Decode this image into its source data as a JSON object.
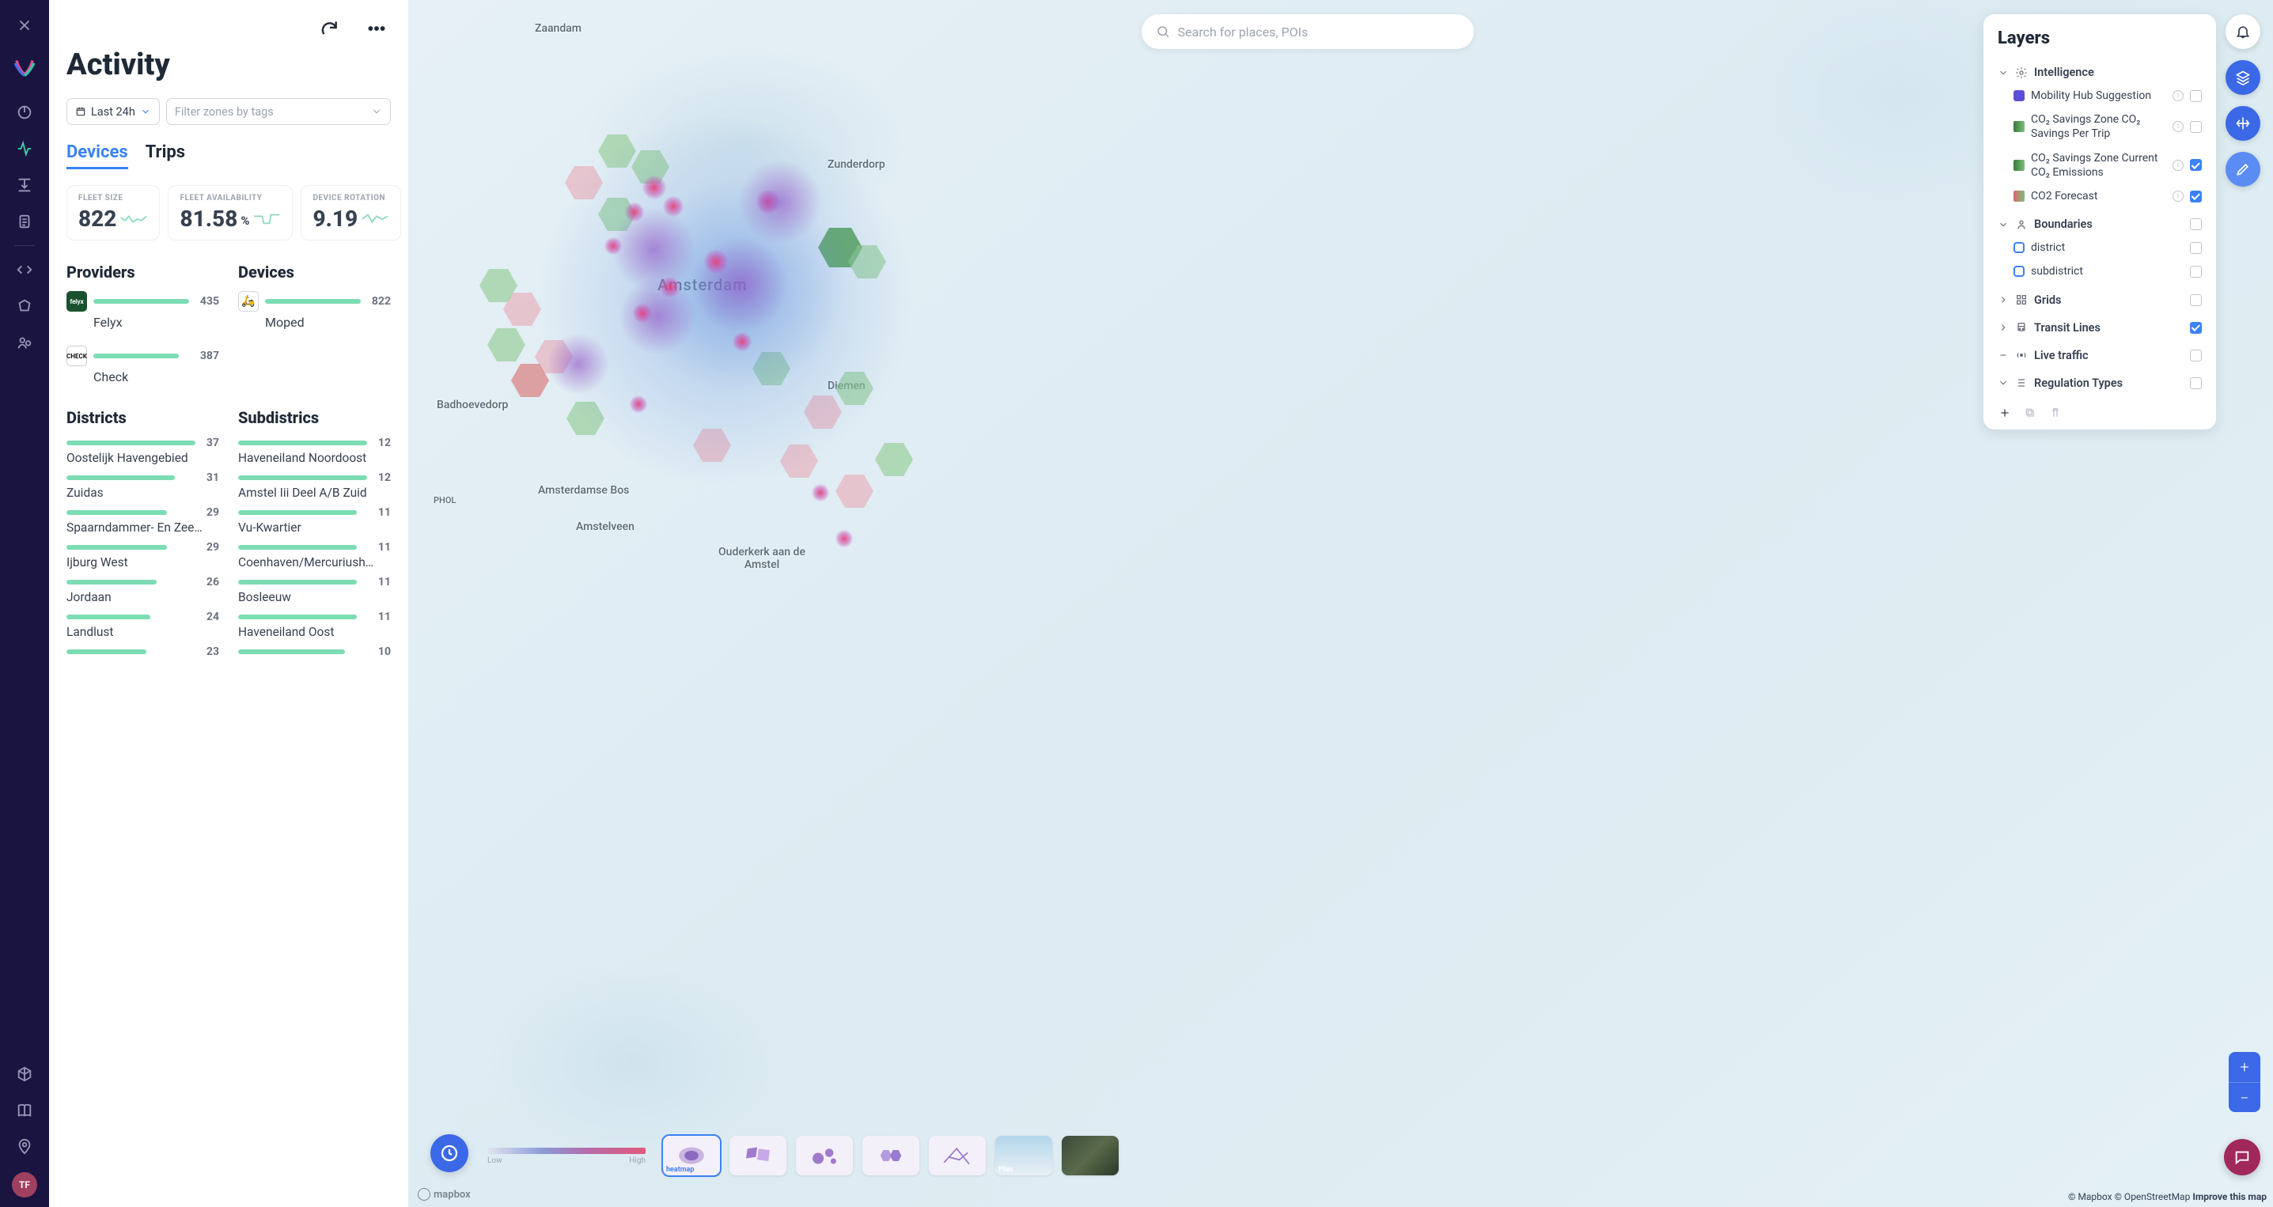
{
  "nav": {
    "avatar_initials": "TF"
  },
  "panel": {
    "title": "Activity",
    "date_filter": "Last 24h",
    "tag_filter_placeholder": "Filter zones by tags",
    "tabs": {
      "devices": "Devices",
      "trips": "Trips",
      "active": "devices"
    },
    "metrics": [
      {
        "label": "FLEET SIZE",
        "value": "822",
        "unit": ""
      },
      {
        "label": "FLEET AVAILABILITY",
        "value": "81.58",
        "unit": "%"
      },
      {
        "label": "DEVICE ROTATION",
        "value": "9.19",
        "unit": ""
      }
    ],
    "providers_title": "Providers",
    "providers": [
      {
        "name": "Felyx",
        "count": "435",
        "width": 100
      },
      {
        "name": "Check",
        "count": "387",
        "width": 89
      }
    ],
    "devices_title": "Devices",
    "devices": [
      {
        "name": "Moped",
        "count": "822",
        "width": 100
      }
    ],
    "districts_title": "Districts",
    "districts": [
      {
        "name": "Oostelijk Havengebied",
        "count": "37",
        "width": 100
      },
      {
        "name": "Zuidas",
        "count": "31",
        "width": 84
      },
      {
        "name": "Spaarndammer- En Zee…",
        "count": "29",
        "width": 78
      },
      {
        "name": "Ijburg West",
        "count": "29",
        "width": 78
      },
      {
        "name": "Jordaan",
        "count": "26",
        "width": 70
      },
      {
        "name": "Landlust",
        "count": "24",
        "width": 65
      },
      {
        "name": "",
        "count": "23",
        "width": 62
      }
    ],
    "subdistricts_title": "Subdistrics",
    "subdistricts": [
      {
        "name": "Haveneiland Noordoost",
        "count": "12",
        "width": 100
      },
      {
        "name": "Amstel Iii Deel A/B Zuid",
        "count": "12",
        "width": 100
      },
      {
        "name": "Vu-Kwartier",
        "count": "11",
        "width": 92
      },
      {
        "name": "Coenhaven/Mercuriush…",
        "count": "11",
        "width": 92
      },
      {
        "name": "Bosleeuw",
        "count": "11",
        "width": 92
      },
      {
        "name": "Haveneiland Oost",
        "count": "11",
        "width": 92
      },
      {
        "name": "",
        "count": "10",
        "width": 83
      }
    ]
  },
  "map": {
    "labels": {
      "zaandam": "Zaandam",
      "zunderdorp": "Zunderdorp",
      "amsterdam": "Amsterdam",
      "diemen": "Diemen",
      "badhoevedorp": "Badhoevedorp",
      "amsterdamse_bos": "Amsterdamse Bos",
      "amstelveen": "Amstelveen",
      "ouderkerk": "Ouderkerk aan de Amstel",
      "phol": "PHOL"
    },
    "search_placeholder": "Search for places, POIs",
    "legend": {
      "low": "Low",
      "high": "High"
    },
    "style_active_label": "heatmap",
    "style_plan_label": "Plan",
    "attribution": {
      "mapbox": "© Mapbox",
      "osm": "© OpenStreetMap",
      "improve": "Improve this map"
    },
    "mapbox_brand": "mapbox"
  },
  "layers": {
    "title": "Layers",
    "groups": {
      "intelligence": {
        "title": "Intelligence",
        "items": [
          {
            "name": "Mobility Hub Suggestion",
            "swatch": "purple",
            "info": true,
            "checked": false
          },
          {
            "name": "CO₂ Savings Zone CO₂ Savings Per Trip",
            "swatch": "greenbar",
            "info": true,
            "checked": false
          },
          {
            "name": "CO₂ Savings Zone Current CO₂ Emissions",
            "swatch": "greenbar",
            "info": true,
            "checked": true
          },
          {
            "name": "CO2 Forecast",
            "swatch": "redgreen",
            "info": true,
            "checked": true
          }
        ]
      },
      "boundaries": {
        "title": "Boundaries",
        "items": [
          {
            "name": "district",
            "swatch": "outline",
            "checked": false
          },
          {
            "name": "subdistrict",
            "swatch": "outline",
            "checked": false
          }
        ]
      },
      "grids": {
        "title": "Grids"
      },
      "transit": {
        "title": "Transit Lines",
        "checked": true
      },
      "traffic": {
        "title": "Live traffic",
        "checked": false
      },
      "regulation": {
        "title": "Regulation Types"
      }
    }
  }
}
